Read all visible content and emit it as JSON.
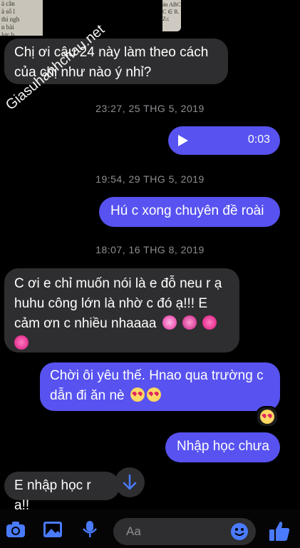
{
  "watermark": "Giasuhanhchau.net",
  "photo_snippet": "ản ABC\nC ∈ R.\nZ≤",
  "photo_left_snippet": "ả cân\nà số l\nthi ngh\nn bài\nlực b",
  "messages": [
    {
      "id": "m1",
      "dir": "in",
      "text": "Chị ơi câu 24 này làm theo cách của chị như nào ý nhỉ?"
    },
    {
      "id": "ts1",
      "type": "timestamp",
      "text": "23:27, 25 THG 5, 2019"
    },
    {
      "id": "m2",
      "dir": "out",
      "type": "audio",
      "duration": "0:03"
    },
    {
      "id": "ts2",
      "type": "timestamp",
      "text": "19:54, 29 THG 5, 2019"
    },
    {
      "id": "m3",
      "dir": "out",
      "text": "Hú c xong chuyên đề roài"
    },
    {
      "id": "ts3",
      "type": "timestamp",
      "text": "18:07, 16 THG 8, 2019"
    },
    {
      "id": "m4",
      "dir": "in",
      "text_line1": "C ơi e chỉ muốn nói là e đỗ neu r ạ",
      "text_line2": "huhu công lớn là nhờ c đó ạ!!! E",
      "text_line3": "cảm ơn c nhiều nhaaaa",
      "emojis": [
        "sparkling-heart",
        "two-hearts",
        "beating-heart",
        "growing-heart"
      ]
    },
    {
      "id": "m5",
      "dir": "out",
      "text_line1": "Chời ôi yêu thế. Hnao qua trường c",
      "text_line2": "dẫn đi ăn nè",
      "reaction": "heart-eyes"
    },
    {
      "id": "m6",
      "dir": "out",
      "text": "Nhập học chưa"
    },
    {
      "id": "m7",
      "dir": "in",
      "text": "E nhập học r ạ!!"
    }
  ],
  "composer": {
    "placeholder": "Aa"
  },
  "colors": {
    "outgoing": "#5752f0",
    "incoming": "#2e2e30",
    "background": "#000000",
    "accent": "#4a7bff"
  }
}
